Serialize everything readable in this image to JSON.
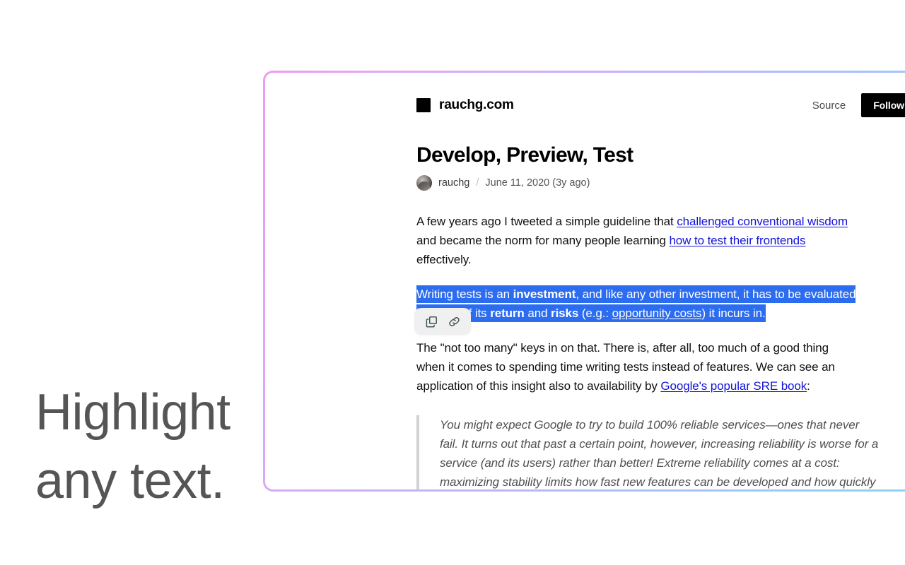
{
  "promo": {
    "line1": "Highlight",
    "line2": "any text."
  },
  "card": {
    "border_gradient_from": "#ee9bf5",
    "border_gradient_to": "#86d6f3"
  },
  "site_header": {
    "brand_name": "rauchg.com",
    "brand_mark": "black-square-logo",
    "source_label": "Source",
    "follow_label": "Follow Me"
  },
  "post": {
    "title": "Develop, Preview, Test",
    "author": "rauchg",
    "separator": "/",
    "date": "June 11, 2020 (3y ago)",
    "paragraph1": {
      "part1": "A few years ago I tweeted a simple guideline that ",
      "link1": "challenged conventional wisdom",
      "part2": " and became the norm for many people learning ",
      "link2": "how to test their frontends",
      "part3": " effectively."
    },
    "paragraph2_selected": {
      "t1": "Writing tests is an ",
      "b1": "investment",
      "t2": ", and like any other investment, it has to be evaluated in terms of its ",
      "b2": "return",
      "t3": " and ",
      "b3": "risks",
      "t4": " (e.g.: ",
      "link": "opportunity costs",
      "t5": ") it incurs in.",
      "highlight_color": "#2c6df0",
      "highlight_text_color": "#ffffff"
    },
    "paragraph3": {
      "part1": "The \"not too many\" keys in on that. There is, after all, too much of a good thing when it comes to spending time writing tests instead of features. We can see an application of this insight also to availability by ",
      "link": "Google's popular SRE book",
      "part2": ":"
    },
    "blockquote": "You might expect Google to try to build 100% reliable services—ones that never fail. It turns out that past a certain point, however, increasing reliability is worse for a service (and its users) rather than better! Extreme reliability comes at a cost: maximizing stability limits how fast new features can be developed and how quickly products can be delivered to users, and"
  },
  "selection_toolbar": {
    "copy_icon": "copy-icon",
    "link_icon": "link-icon",
    "background": "#f0f0f0"
  }
}
